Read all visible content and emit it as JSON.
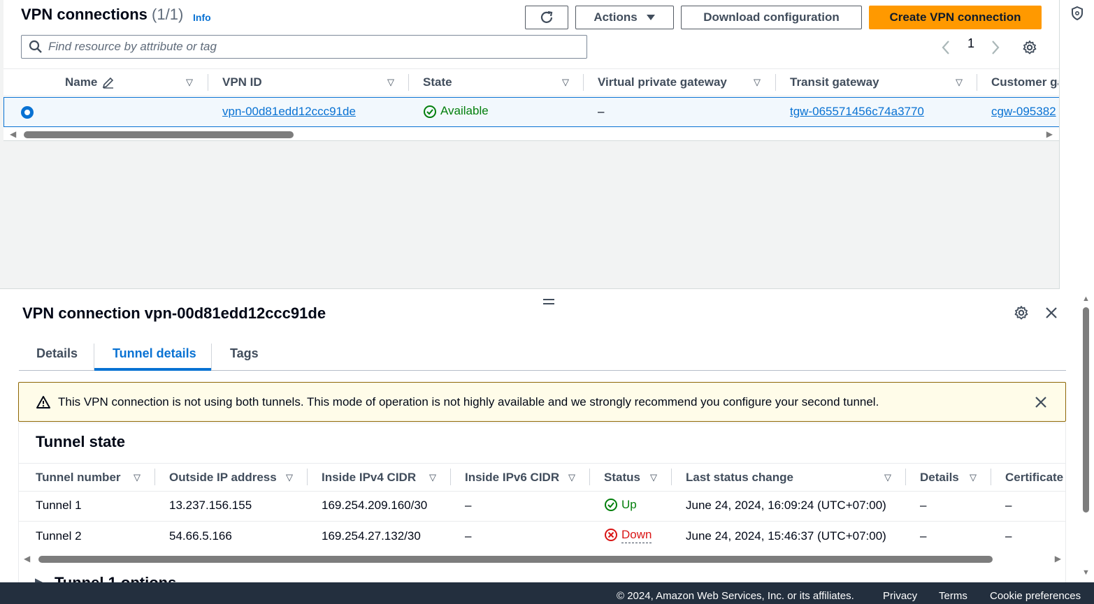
{
  "list": {
    "title": "VPN connections",
    "count": "(1/1)",
    "info": "Info",
    "refresh_icon": "refresh-icon",
    "actions_label": "Actions",
    "download_label": "Download configuration",
    "create_label": "Create VPN connection",
    "search_placeholder": "Find resource by attribute or tag",
    "page_number": "1",
    "columns": [
      "Name",
      "VPN ID",
      "State",
      "Virtual private gateway",
      "Transit gateway",
      "Customer ga"
    ],
    "row": {
      "name": "",
      "vpn_id": "vpn-00d81edd12ccc91de",
      "state": "Available",
      "vgw": "–",
      "tgw": "tgw-065571456c74a3770",
      "cgw": "cgw-095382"
    }
  },
  "detail": {
    "title": "VPN connection vpn-00d81edd12ccc91de",
    "tabs": [
      "Details",
      "Tunnel details",
      "Tags"
    ],
    "active_tab": "Tunnel details",
    "alert": "This VPN connection is not using both tunnels. This mode of operation is not highly available and we strongly recommend you configure your second tunnel.",
    "section_title": "Tunnel state",
    "columns": [
      "Tunnel number",
      "Outside IP address",
      "Inside IPv4 CIDR",
      "Inside IPv6 CIDR",
      "Status",
      "Last status change",
      "Details",
      "Certificate"
    ],
    "rows": [
      {
        "tunnel": "Tunnel 1",
        "outside_ip": "13.237.156.155",
        "ipv4": "169.254.209.160/30",
        "ipv6": "–",
        "status": "Up",
        "last_change": "June 24, 2024, 16:09:24 (UTC+07:00)",
        "details": "–",
        "certificate": "–"
      },
      {
        "tunnel": "Tunnel 2",
        "outside_ip": "54.66.5.166",
        "ipv4": "169.254.27.132/30",
        "ipv6": "–",
        "status": "Down",
        "last_change": "June 24, 2024, 15:46:37 (UTC+07:00)",
        "details": "–",
        "certificate": "–"
      }
    ],
    "next_section_partial": "Tunnel 1 options"
  },
  "footer": {
    "copyright": "© 2024, Amazon Web Services, Inc. or its affiliates.",
    "privacy": "Privacy",
    "terms": "Terms",
    "cookies": "Cookie preferences"
  },
  "colors": {
    "primary": "#ff9900",
    "link": "#0972d3",
    "success": "#037f0c",
    "error": "#d91515",
    "warning_bg": "#fffce9",
    "footer_bg": "#232f3e"
  }
}
